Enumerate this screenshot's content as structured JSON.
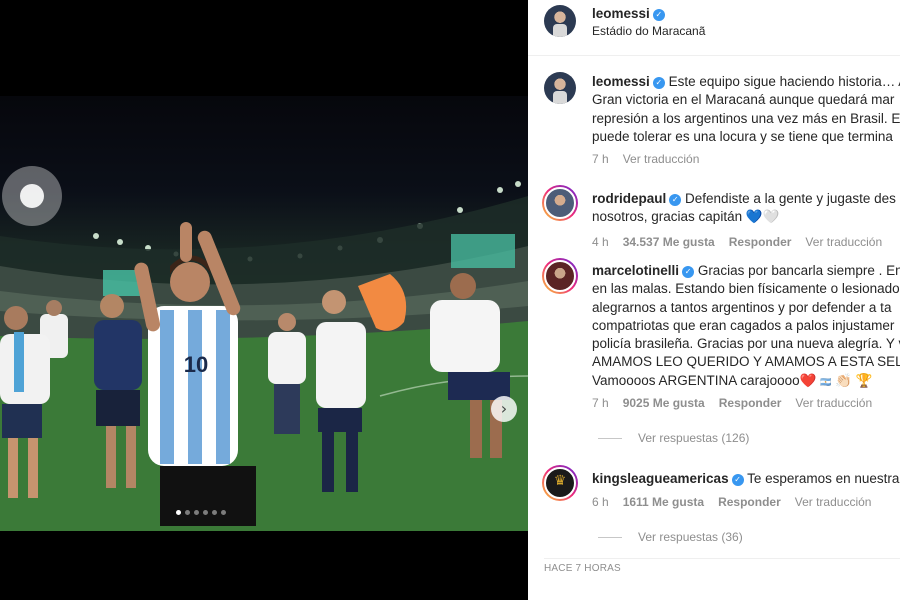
{
  "post": {
    "username": "leomessi",
    "location": "Estádio do Maracanã",
    "photo_number": "10",
    "carousel": {
      "total": 6,
      "active": 0
    }
  },
  "comments": [
    {
      "username": "leomessi",
      "lines": [
        "Este equipo sigue haciendo historia… A",
        "Gran victoria en el Maracaná aunque quedará mar",
        "represión a los argentinos una vez más en Brasil. E",
        "puede tolerar es una locura y se tiene que termina"
      ],
      "time": "7 h",
      "likes": "",
      "reply": "",
      "translate": "Ver traducción"
    },
    {
      "username": "rodridepaul",
      "lines": [
        "Defendiste a la gente y jugaste des",
        "nosotros, gracias capitán"
      ],
      "emoji": [
        "💙",
        "🤍"
      ],
      "time": "4 h",
      "likes": "34.537 Me gusta",
      "reply": "Responder",
      "translate": "Ver traducción"
    },
    {
      "username": "marcelotinelli",
      "lines": [
        "Gracias por bancarla siempre . En",
        "en las malas. Estando bien físicamente o lesionado",
        "alegrarnos a tantos argentinos y por defender a ta",
        "compatriotas que eran cagados a palos injustamer",
        "policía brasileña. Gracias por una nueva alegría. Y v",
        "AMAMOS LEO QUERIDO Y AMAMOS A ESTA SELEC",
        "Vamoooos ARGENTINA carajoooo"
      ],
      "emoji": [
        "❤️",
        "🇦🇷",
        "👏🏻",
        "🏆"
      ],
      "time": "7 h",
      "likes": "9025 Me gusta",
      "reply": "Responder",
      "translate": "Ver traducción",
      "view_replies": "Ver respuestas (126)"
    },
    {
      "username": "kingsleagueamericas",
      "lines": [
        "Te esperamos en nuestra l"
      ],
      "time": "6 h",
      "likes": "1611 Me gusta",
      "reply": "Responder",
      "translate": "Ver traducción",
      "view_replies": "Ver respuestas (36)"
    }
  ],
  "footer": {
    "timestamp": "HACE 7 HORAS"
  },
  "icons": {
    "verified": "verified-badge-icon",
    "next": "chevron-right-icon",
    "logo": "afa-crest-icon"
  },
  "colors": {
    "verified": "#3897f0",
    "secondary_text": "#8e8e8e",
    "shirt_blue": "#75aadb",
    "pitch_green": "#3e7b3a"
  }
}
